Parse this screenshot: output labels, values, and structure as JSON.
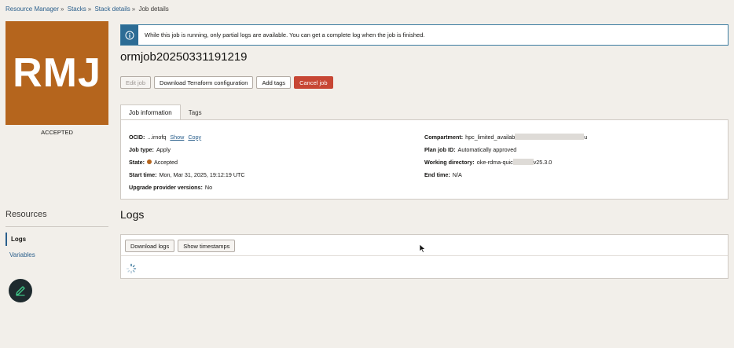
{
  "breadcrumb": {
    "items": [
      "Resource Manager",
      "Stacks",
      "Stack details"
    ],
    "current": "Job details",
    "separator": "»"
  },
  "badge": {
    "initials": "RMJ",
    "status": "ACCEPTED",
    "color": "#b5651d"
  },
  "banner": {
    "message": "While this job is running, only partial logs are available. You can get a complete log when the job is finished.",
    "icon": "info-icon"
  },
  "job": {
    "title": "ormjob20250331191219"
  },
  "actions": {
    "edit": "Edit job",
    "download_tf": "Download Terraform configuration",
    "add_tags": "Add tags",
    "cancel": "Cancel job"
  },
  "tabs": [
    "Job information",
    "Tags"
  ],
  "job_info": {
    "left": {
      "ocid_label": "OCID:",
      "ocid_value": "...irnofq",
      "show": "Show",
      "copy": "Copy",
      "job_type_label": "Job type:",
      "job_type_value": "Apply",
      "state_label": "State:",
      "state_value": "Accepted",
      "start_time_label": "Start time:",
      "start_time_value": "Mon, Mar 31, 2025, 19:12:19 UTC",
      "upgrade_label": "Upgrade provider versions:",
      "upgrade_value": "No"
    },
    "right": {
      "compartment_label": "Compartment:",
      "compartment_value_start": "hpc_limited_availab",
      "compartment_value_end": "u",
      "plan_job_label": "Plan job ID:",
      "plan_job_value": "Automatically approved",
      "working_dir_label": "Working directory:",
      "working_dir_value_start": "oke-rdma-quic",
      "working_dir_value_end": "v25.3.0",
      "end_time_label": "End time:",
      "end_time_value": "N/A"
    }
  },
  "resources": {
    "title": "Resources",
    "items": [
      "Logs",
      "Variables"
    ],
    "active": "Logs"
  },
  "logs": {
    "title": "Logs",
    "download": "Download logs",
    "timestamps": "Show timestamps"
  },
  "colors": {
    "accent": "#2a5f8c",
    "danger": "#c74634",
    "badge": "#b5651d"
  }
}
